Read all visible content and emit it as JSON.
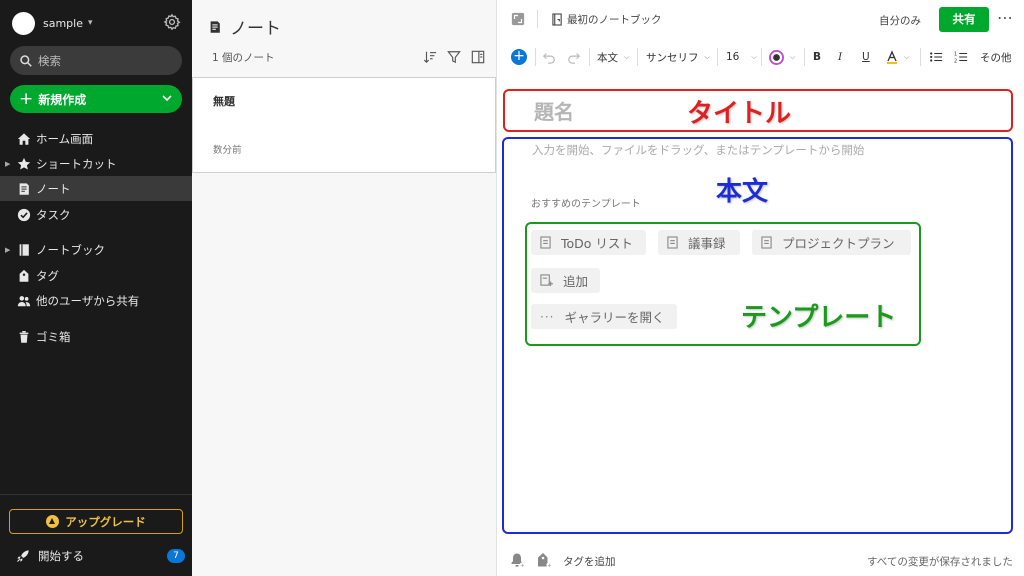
{
  "account": {
    "name": "sample"
  },
  "sidebar": {
    "search_placeholder": "検索",
    "new_label": "新規作成",
    "items": [
      {
        "label": "ホーム画面"
      },
      {
        "label": "ショートカット"
      },
      {
        "label": "ノート"
      },
      {
        "label": "タスク"
      },
      {
        "label": "ノートブック"
      },
      {
        "label": "タグ"
      },
      {
        "label": "他のユーザから共有"
      },
      {
        "label": "ゴミ箱"
      }
    ],
    "upgrade_label": "アップグレード",
    "start_label": "開始する",
    "start_badge": "7"
  },
  "notelist": {
    "title": "ノート",
    "count": "1 個のノート",
    "notes": [
      {
        "title": "無題",
        "date": "数分前"
      }
    ]
  },
  "editor": {
    "notebook": "最初のノートブック",
    "visibility": "自分のみ",
    "share_label": "共有",
    "toolbar": {
      "style": "本文",
      "font": "サンセリフ",
      "size": "16",
      "more": "その他"
    },
    "title_placeholder": "題名",
    "body_hint": "入力を開始、ファイルをドラッグ、またはテンプレートから開始",
    "recommended_label": "おすすめのテンプレート",
    "templates": [
      {
        "label": "ToDo リスト"
      },
      {
        "label": "議事録"
      },
      {
        "label": "プロジェクトプラン"
      },
      {
        "label": "追加"
      },
      {
        "label": "ギャラリーを開く"
      }
    ],
    "add_tag": "タグを追加",
    "saved_status": "すべての変更が保存されました"
  },
  "annotations": {
    "title": "タイトル",
    "body": "本文",
    "template": "テンプレート",
    "colors": {
      "title": "#e02020",
      "body": "#1e2cd8",
      "template": "#1a9a1a"
    }
  },
  "colors": {
    "accent_green": "#00a82d",
    "sidebar_bg": "#1a1a1a",
    "badge_blue": "#0a76d6",
    "upgrade_gold": "#d4a017"
  }
}
